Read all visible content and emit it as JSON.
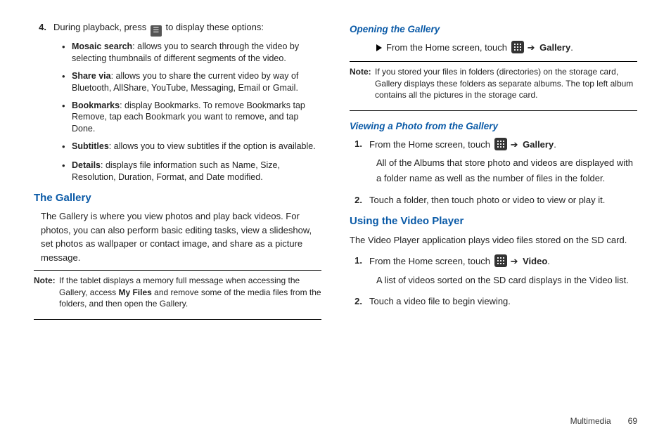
{
  "left": {
    "step4": {
      "num": "4.",
      "pre": "During playback, press ",
      "post": " to display these options:"
    },
    "bullets": [
      {
        "term": "Mosaic search",
        "desc": ": allows you to search through the video by selecting thumbnails of different segments of the video."
      },
      {
        "term": "Share via",
        "desc": ": allows you to share the current video by way of Bluetooth, AllShare, YouTube, Messaging, Email or Gmail."
      },
      {
        "term": "Bookmarks",
        "desc": ": display Bookmarks. To remove Bookmarks tap Remove, tap each Bookmark you want to remove, and tap Done."
      },
      {
        "term": "Subtitles",
        "desc": ": allows you to view subtitles if the option is available."
      },
      {
        "term": "Details",
        "desc": ": displays file information such as Name, Size, Resolution, Duration, Format, and Date modified."
      }
    ],
    "galleryHeading": "The Gallery",
    "galleryPara": "The Gallery is where you view photos and play back videos. For photos, you can also perform basic editing tasks, view a slideshow, set photos as wallpaper or contact image, and share as a picture message.",
    "noteLabel": "Note:",
    "noteBody1": "If the tablet displays a memory full message when accessing the Gallery, access ",
    "noteBold": "My Files",
    "noteBody2": " and remove some of the media files from the folders, and then open the Gallery."
  },
  "right": {
    "openingHeading": "Opening the Gallery",
    "openStepPre": "From the Home screen, touch ",
    "arrow": "➔",
    "galleryLabel": "Gallery",
    "noteLabel": "Note:",
    "noteBody": "If you stored your files in folders (directories) on the storage card, Gallery displays these folders as separate albums. The top left album contains all the pictures in the storage card.",
    "viewingHeading": "Viewing a Photo from the Gallery",
    "vstep1": {
      "num": "1.",
      "pre": "From the Home screen, touch ",
      "after": "All of the Albums that store photo and videos are displayed with a folder name as well as the number of files in the folder."
    },
    "vstep2": {
      "num": "2.",
      "text": "Touch a folder, then touch photo or video to view or play it."
    },
    "videoHeading": "Using the Video Player",
    "videoPara": "The Video Player application plays video files stored on the SD card.",
    "vp1": {
      "num": "1.",
      "pre": "From the Home screen, touch ",
      "label": "Video",
      "after": "A list of videos sorted on the SD card displays in the Video list."
    },
    "vp2": {
      "num": "2.",
      "text": "Touch a video file to begin viewing."
    }
  },
  "footer": {
    "section": "Multimedia",
    "page": "69"
  }
}
